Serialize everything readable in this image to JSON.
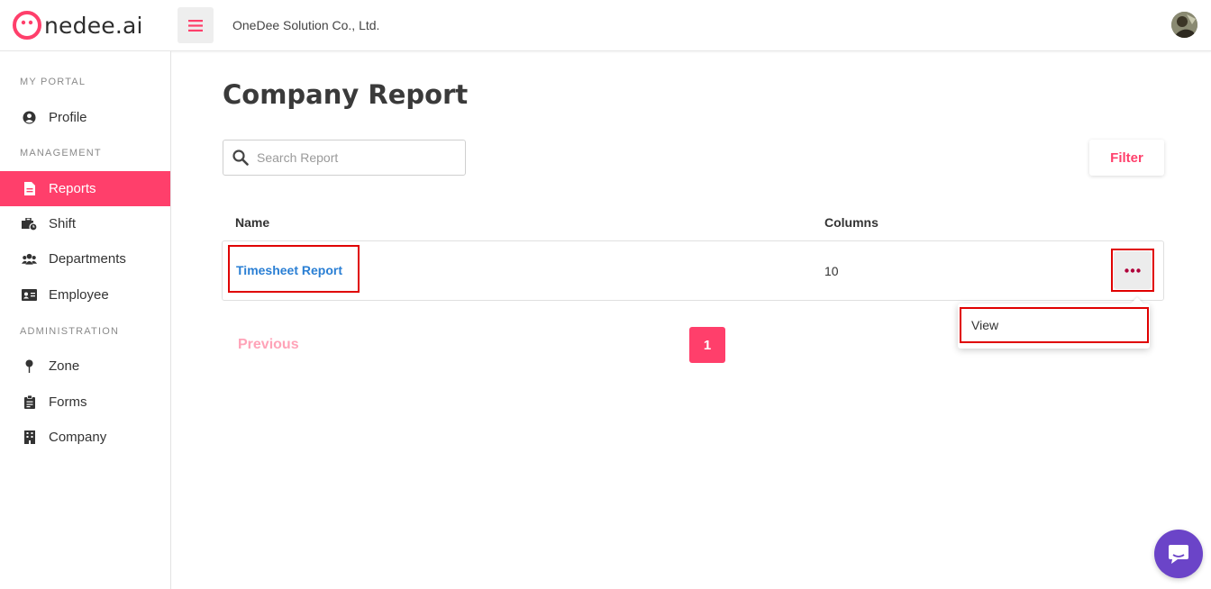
{
  "brand": {
    "logo_text": "nedee.ai",
    "accent": "#ff3f6b"
  },
  "header": {
    "company_name": "OneDee Solution Co., Ltd."
  },
  "sidebar": {
    "sections": [
      {
        "label": "MY PORTAL"
      },
      {
        "label": "MANAGEMENT"
      },
      {
        "label": "ADMINISTRATION"
      }
    ],
    "items": [
      {
        "label": "Profile",
        "icon": "user-circle-icon"
      },
      {
        "label": "Reports",
        "icon": "file-icon",
        "active": true
      },
      {
        "label": "Shift",
        "icon": "briefcase-clock-icon"
      },
      {
        "label": "Departments",
        "icon": "users-icon"
      },
      {
        "label": "Employee",
        "icon": "id-card-icon"
      },
      {
        "label": "Zone",
        "icon": "map-pin-icon"
      },
      {
        "label": "Forms",
        "icon": "clipboard-icon"
      },
      {
        "label": "Company",
        "icon": "building-icon"
      }
    ]
  },
  "main": {
    "title": "Company Report",
    "search": {
      "placeholder": "Search Report",
      "value": ""
    },
    "filter_label": "Filter",
    "table": {
      "columns": [
        "Name",
        "Columns"
      ],
      "rows": [
        {
          "name": "Timesheet Report",
          "columns": "10"
        }
      ]
    },
    "row_menu": {
      "items": [
        "View"
      ]
    },
    "pagination": {
      "previous_label": "Previous",
      "current_page": "1"
    }
  }
}
